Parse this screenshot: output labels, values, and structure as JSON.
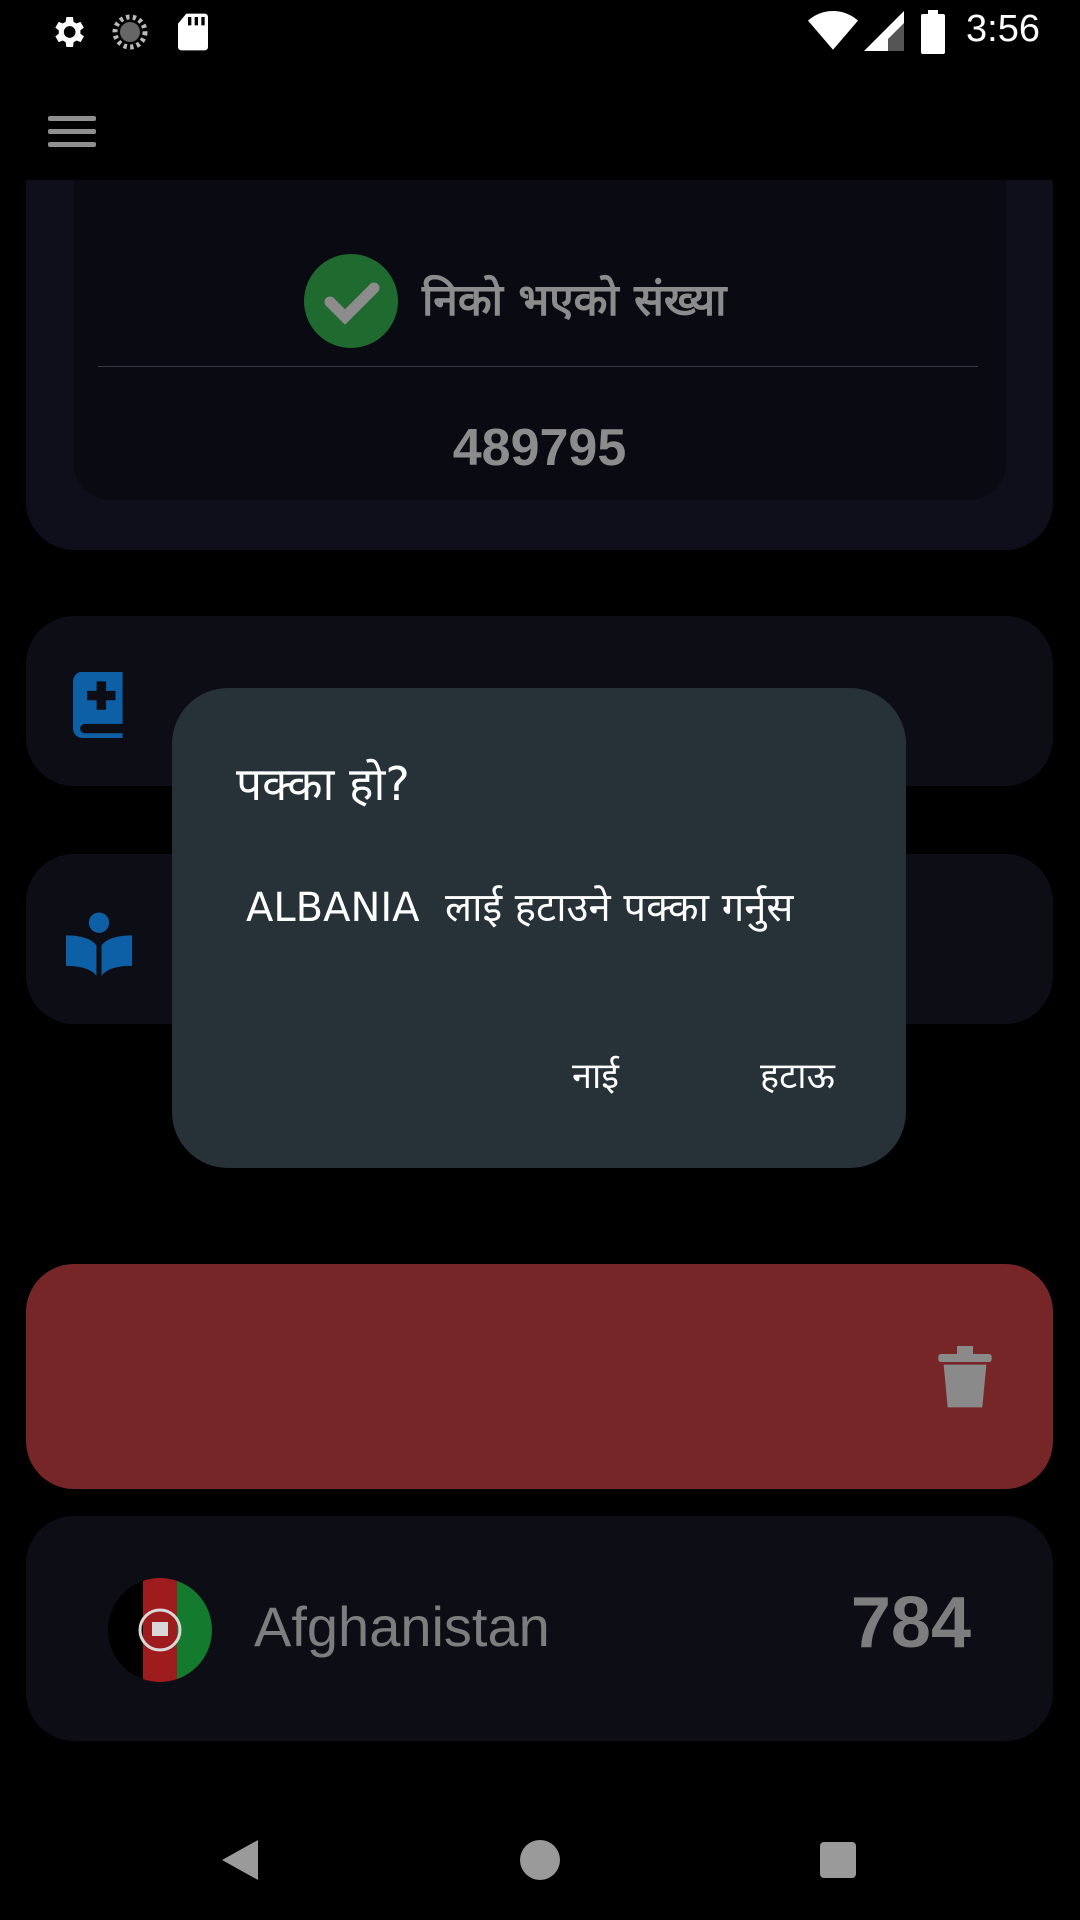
{
  "status_bar": {
    "time": "3:56",
    "icons": [
      "settings-icon",
      "sync-icon",
      "sd-card-icon",
      "wifi-icon",
      "signal-icon",
      "battery-icon"
    ]
  },
  "app_bar": {
    "menu_icon": "hamburger-menu-icon"
  },
  "recovered": {
    "title": "निको भएको संख्या",
    "value": "489795",
    "icon": "check-circle-icon",
    "icon_color": "#1f6a2f"
  },
  "rows": [
    {
      "icon": "medical-book-icon",
      "label_peek": "",
      "icon_color": "#0d5fa6"
    },
    {
      "icon": "reading-person-icon",
      "label_peek": "",
      "icon_color": "#0d5fa6"
    }
  ],
  "swipe_delete": {
    "icon": "trash-icon",
    "background": "#772628"
  },
  "country": {
    "name": "Afghanistan",
    "count": "784",
    "flag_icon": "afghanistan-flag-icon"
  },
  "dialog": {
    "title": "पक्का हो?",
    "message": "ALBANIA  लाई हटाउने पक्का गर्नुस",
    "cancel_label": "नाई",
    "confirm_label": "हटाऊ",
    "background": "#263238"
  },
  "nav_bar": {
    "icons": [
      "back-icon",
      "home-icon",
      "recents-icon"
    ]
  }
}
